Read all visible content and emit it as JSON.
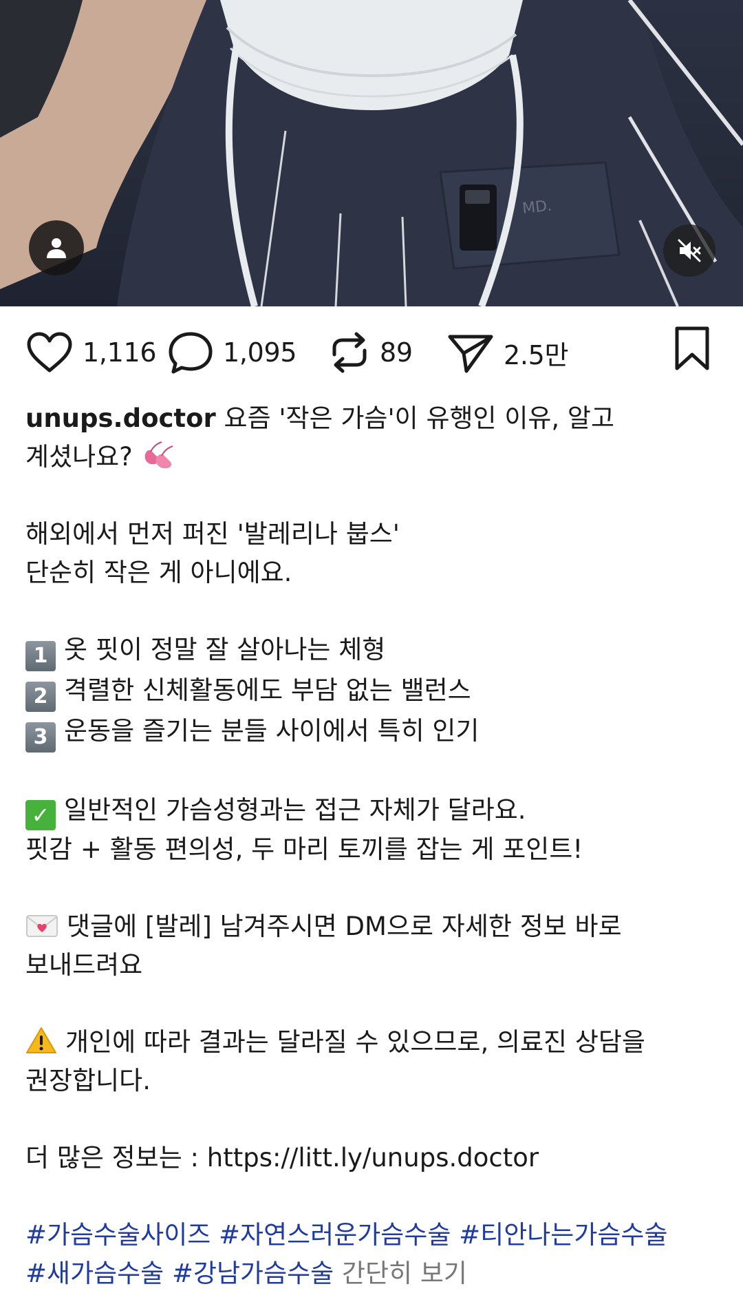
{
  "post": {
    "stats": {
      "likes": "1,116",
      "comments": "1,095",
      "reposts": "89",
      "shares": "2.5만"
    },
    "username": "unups.doctor",
    "caption_lines": [
      " 요즘 '작은 가슴'이 유행인 이유, 알고",
      "계셨나요? ",
      "",
      "해외에서 먼저 퍼진 '발레리나 붑스'",
      "단순히 작은 게 아니에요.",
      "",
      "옷 핏이 정말 잘 살아나는 체형",
      "격렬한 신체활동에도 부담 없는 밸런스",
      "운동을 즐기는 분들 사이에서 특히 인기",
      "",
      "일반적인 가슴성형과는 접근 자체가 달라요.",
      "핏감 + 활동 편의성, 두 마리 토끼를 잡는 게 포인트!",
      "",
      "댓글에 [발레] 남겨주시면 DM으로 자세한 정보 바로",
      "보내드려요",
      "",
      "개인에 따라 결과는 달라질 수 있으므로, 의료진 상담을",
      "권장합니다.",
      "",
      "더 많은 정보는 : https://litt.ly/unups.doctor",
      ""
    ],
    "keycaps": [
      "1",
      "2",
      "3"
    ],
    "hashtags_line1": "#가슴수술사이즈 #자연스러운가슴수술 #티안나는가슴수술",
    "hashtags_line2": "#새가슴수술 #강남가슴수술",
    "more_label": " 간단히 보기"
  },
  "icons": {
    "media_user_tag": "person-icon",
    "media_mute": "speaker-muted-icon",
    "like": "heart-icon",
    "comment": "comment-bubble-icon",
    "repost": "repost-arrows-icon",
    "share": "paper-plane-icon",
    "save": "bookmark-icon",
    "ballet_emoji": "ballet-shoes-emoji",
    "check_emoji": "check-mark-emoji",
    "envelope_emoji": "love-letter-emoji",
    "warning_emoji": "warning-emoji"
  },
  "colors": {
    "hashtag": "#1f3b9f",
    "more": "#777777",
    "text": "#1a1a1a"
  }
}
